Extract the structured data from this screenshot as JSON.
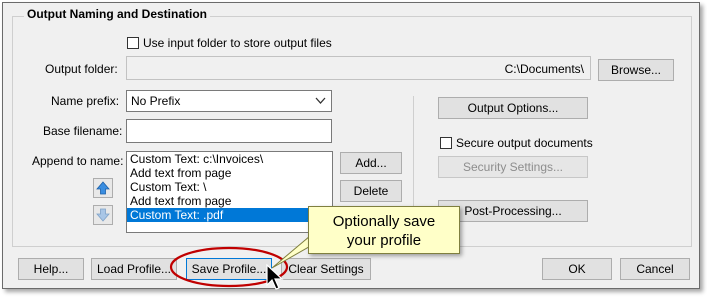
{
  "group": {
    "title": "Output Naming and Destination"
  },
  "use_input_folder": {
    "label": "Use input folder to store output files",
    "checked": false
  },
  "output_folder": {
    "label": "Output folder:",
    "value": "C:\\Documents\\",
    "browse_label": "Browse..."
  },
  "name_prefix": {
    "label": "Name prefix:",
    "selected": "No Prefix"
  },
  "base_filename": {
    "label": "Base filename:",
    "value": ""
  },
  "append": {
    "label": "Append to name:",
    "items": [
      {
        "text": "Custom Text: c:\\Invoices\\",
        "selected": false
      },
      {
        "text": "Add text from page",
        "selected": false
      },
      {
        "text": "Custom Text: \\",
        "selected": false
      },
      {
        "text": "Add text from page",
        "selected": false
      },
      {
        "text": "Custom Text: .pdf",
        "selected": true
      }
    ],
    "add_label": "Add...",
    "delete_label": "Delete"
  },
  "right_panel": {
    "output_options_label": "Output Options...",
    "secure_label": "Secure output documents",
    "secure_checked": false,
    "security_settings_label": "Security Settings...",
    "post_processing_label": "Post-Processing..."
  },
  "footer": {
    "help_label": "Help...",
    "load_profile_label": "Load Profile...",
    "save_profile_label": "Save Profile...",
    "clear_settings_label": "Clear Settings",
    "ok_label": "OK",
    "cancel_label": "Cancel"
  },
  "callout": {
    "line1": "Optionally save",
    "line2": "your profile"
  },
  "colors": {
    "selection": "#0078d7",
    "callout_bg": "#ffffc8",
    "highlight_ellipse": "#c00000",
    "arrow_blue": "#3a8de0"
  }
}
